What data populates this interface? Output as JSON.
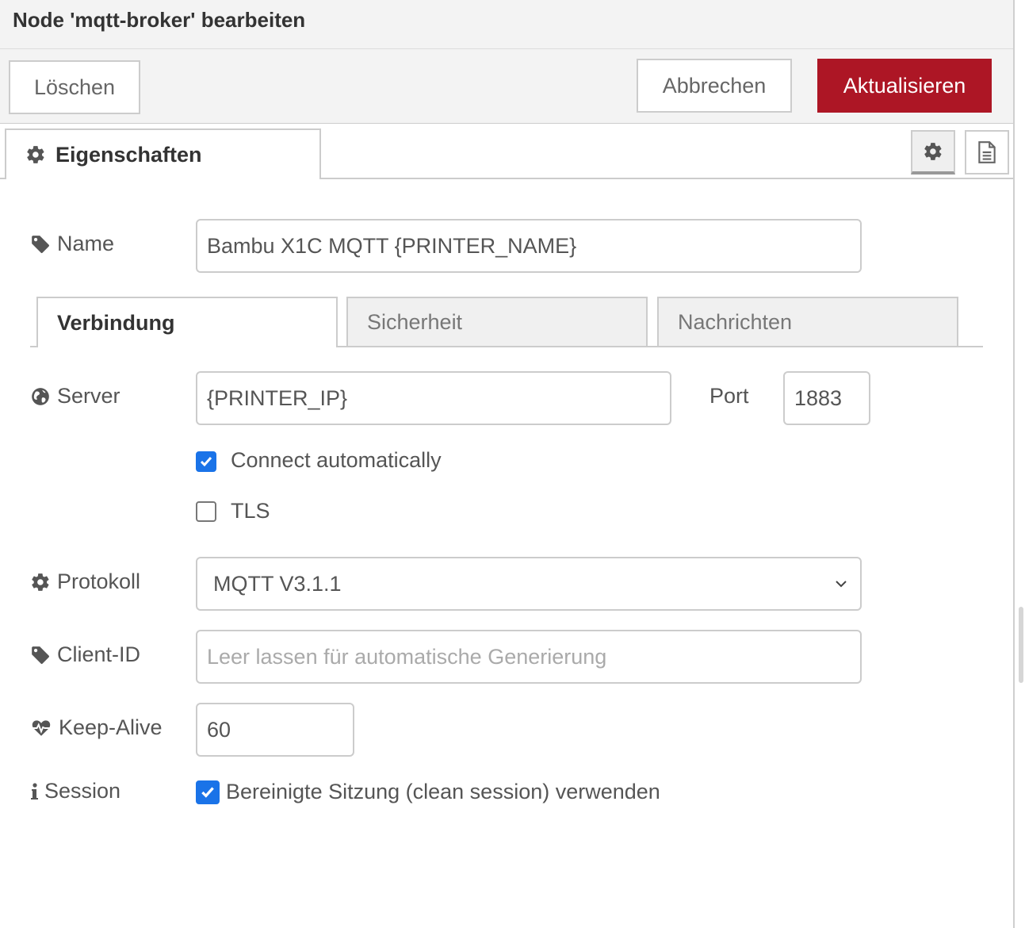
{
  "dialog": {
    "title": "Node 'mqtt-broker' bearbeiten"
  },
  "toolbar": {
    "delete_label": "Löschen",
    "cancel_label": "Abbrechen",
    "update_label": "Aktualisieren"
  },
  "tabs": {
    "properties_label": "Eigenschaften"
  },
  "form": {
    "name": {
      "label": "Name",
      "value": "Bambu X1C MQTT {PRINTER_NAME}"
    },
    "subtabs": [
      "Verbindung",
      "Sicherheit",
      "Nachrichten"
    ],
    "server": {
      "label": "Server",
      "value": "{PRINTER_IP}"
    },
    "port": {
      "label": "Port",
      "value": "1883"
    },
    "connect_auto": {
      "label": "Connect automatically",
      "checked": true
    },
    "tls": {
      "label": "TLS",
      "checked": false
    },
    "protocol": {
      "label": "Protokoll",
      "value": "MQTT V3.1.1"
    },
    "client_id": {
      "label": "Client-ID",
      "value": "",
      "placeholder": "Leer lassen für automatische Generierung"
    },
    "keepalive": {
      "label": "Keep-Alive",
      "value": "60"
    },
    "session": {
      "label": "Session",
      "checkbox_label": "Bereinigte Sitzung (clean session) verwenden",
      "checked": true
    }
  },
  "colors": {
    "primary": "#ad1625",
    "checkbox": "#1a73e8"
  },
  "icons": [
    "gear-icon",
    "document-icon",
    "tag-icon",
    "globe-icon",
    "heartbeat-icon",
    "info-icon",
    "chevron-down-icon",
    "check-icon"
  ]
}
